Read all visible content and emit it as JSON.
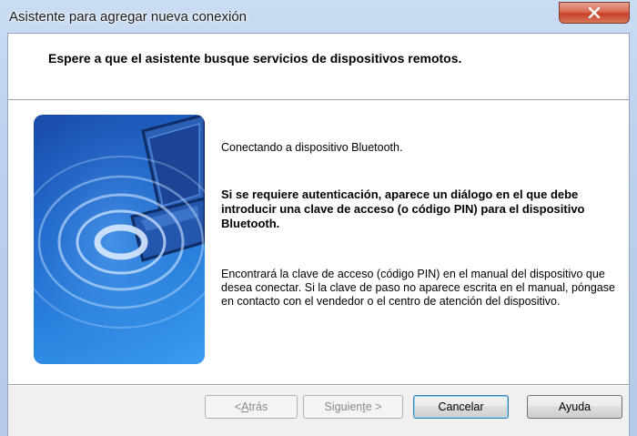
{
  "window": {
    "title": "Asistente para agregar nueva conexión",
    "close_glyph": "✕"
  },
  "header": {
    "instruction": "Espere a que el asistente busque servicios de dispositivos remotos."
  },
  "body": {
    "status": "Conectando a dispositivo Bluetooth.",
    "auth_notice": "Si se requiere autenticación, aparece un diálogo en el que debe introducir una clave de acceso (o código PIN) para el dispositivo Bluetooth.",
    "help_text": "Encontrará la clave de acceso (código PIN) en el manual del dispositivo que desea conectar. Si la clave de paso no aparece escrita en el manual, póngase en contacto con el vendedor o el centro de atención del dispositivo."
  },
  "buttons": {
    "back_prefix": "< ",
    "back_mnemonic": "A",
    "back_rest": "trás",
    "next_prefix": "Siguien",
    "next_mnemonic": "t",
    "next_rest": "e >",
    "cancel": "Cancelar",
    "help": "Ayuda"
  },
  "icons": {
    "illustration": "bluetooth-laptop-signal-icon",
    "close": "close-icon"
  },
  "colors": {
    "close_button": "#c7412a",
    "illustration_blue": "#1f66c9",
    "default_button_border": "#3c7fb1"
  }
}
